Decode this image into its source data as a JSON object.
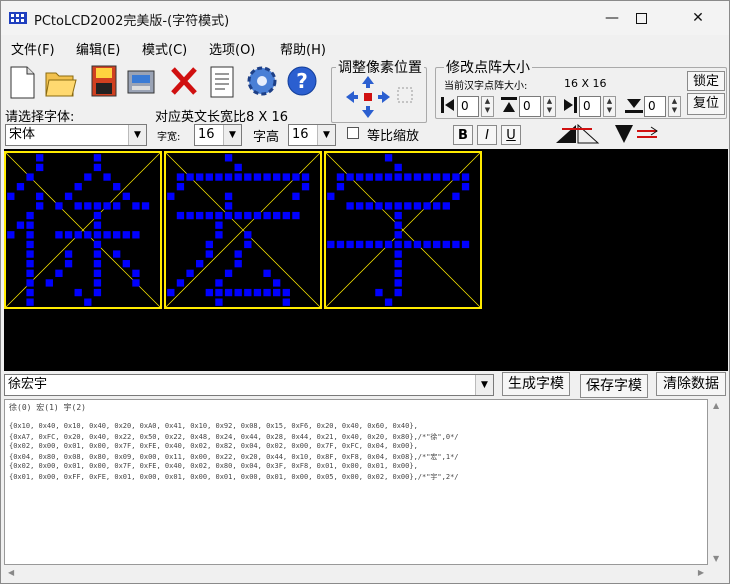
{
  "window": {
    "title": "PCtoLCD2002完美版-(字符模式)"
  },
  "menu": [
    "文件(F)",
    "编辑(E)",
    "模式(C)",
    "选项(O)",
    "帮助(H)"
  ],
  "labels": {
    "select_font": "请选择字体:",
    "en_ratio": "对应英文长宽比8 X 16",
    "width_label": "字宽:",
    "height_label": "字高",
    "keep_ratio": "等比缩放",
    "adjust_pos": "调整像素位置",
    "resize_dots": "修改点阵大小",
    "current_size_label": "当前汉字点阵大小:",
    "current_size_value": "16 X 16"
  },
  "font": {
    "name": "宋体",
    "width": "16",
    "height": "16"
  },
  "buttons": {
    "lock": "锁定",
    "reset": "复位",
    "bold": "B",
    "italic": "I",
    "underline": "U",
    "generate": "生成字模",
    "save": "保存字模",
    "clear": "清除数据"
  },
  "spinners": [
    "0",
    "0",
    "0",
    "0"
  ],
  "input_text": "徐宏宇",
  "output": {
    "header": "徐(0) 宏(1) 宇(2)",
    "lines": [
      "{0x10, 0x40, 0x10, 0x40, 0x20, 0xA0, 0x41, 0x10, 0x92, 0x08, 0x15, 0xF6, 0x20, 0x40, 0x60, 0x40},",
      "{0xA7, 0xFC, 0x20, 0x40, 0x22, 0x50, 0x22, 0x48, 0x24, 0x44, 0x28, 0x44, 0x21, 0x40, 0x20, 0x80},/*\"徐\",0*/",
      "{0x02, 0x00, 0x01, 0x00, 0x7F, 0xFE, 0x40, 0x02, 0x82, 0x04, 0x02, 0x00, 0x7F, 0xFC, 0x04, 0x00},",
      "{0x04, 0x80, 0x08, 0x80, 0x09, 0x00, 0x11, 0x00, 0x22, 0x20, 0x44, 0x10, 0x8F, 0xF8, 0x04, 0x08},/*\"宏\",1*/",
      "{0x02, 0x00, 0x01, 0x00, 0x7F, 0xFE, 0x40, 0x02, 0x80, 0x04, 0x3F, 0xF8, 0x01, 0x00, 0x01, 0x00},",
      "{0x01, 0x00, 0xFF, 0xFE, 0x01, 0x00, 0x01, 0x00, 0x01, 0x00, 0x01, 0x00, 0x05, 0x00, 0x02, 0x00},/*\"宇\",2*/"
    ]
  },
  "colors": {
    "pixel": "#0000ff",
    "grid": "#ffeb00",
    "bg": "#000000"
  }
}
